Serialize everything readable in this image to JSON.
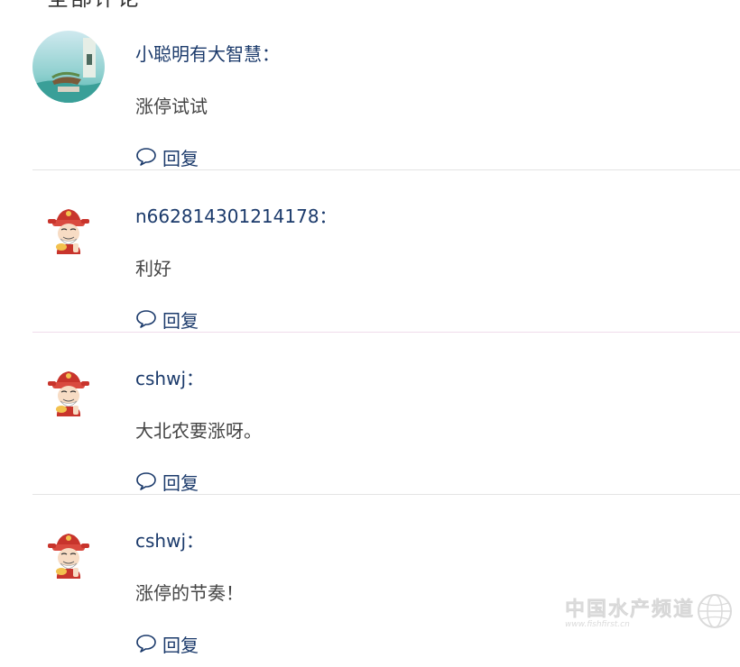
{
  "section": {
    "title": "全部评论"
  },
  "comments": [
    {
      "user": "小聪明有大智慧：",
      "text": "涨停试试",
      "reply": "回复",
      "avatar": "scenic-photo"
    },
    {
      "user": "n662814301214178：",
      "text": "利好",
      "reply": "回复",
      "avatar": "fortune-god-cartoon"
    },
    {
      "user": "cshwj：",
      "text": "大北农要涨呀。",
      "reply": "回复",
      "avatar": "fortune-god-cartoon"
    },
    {
      "user": "cshwj：",
      "text": "涨停的节奏！",
      "reply": "回复",
      "avatar": "fortune-god-cartoon"
    }
  ],
  "icons": {
    "reply": "speech-bubble-icon",
    "watermark": "globe-icon"
  },
  "watermark": {
    "text": "中国水产频道",
    "url": "www.fishfirst.cn"
  },
  "colors": {
    "username": "#1b3a6b",
    "reply": "#1b3a6b",
    "divider": "#e4e4e4"
  }
}
